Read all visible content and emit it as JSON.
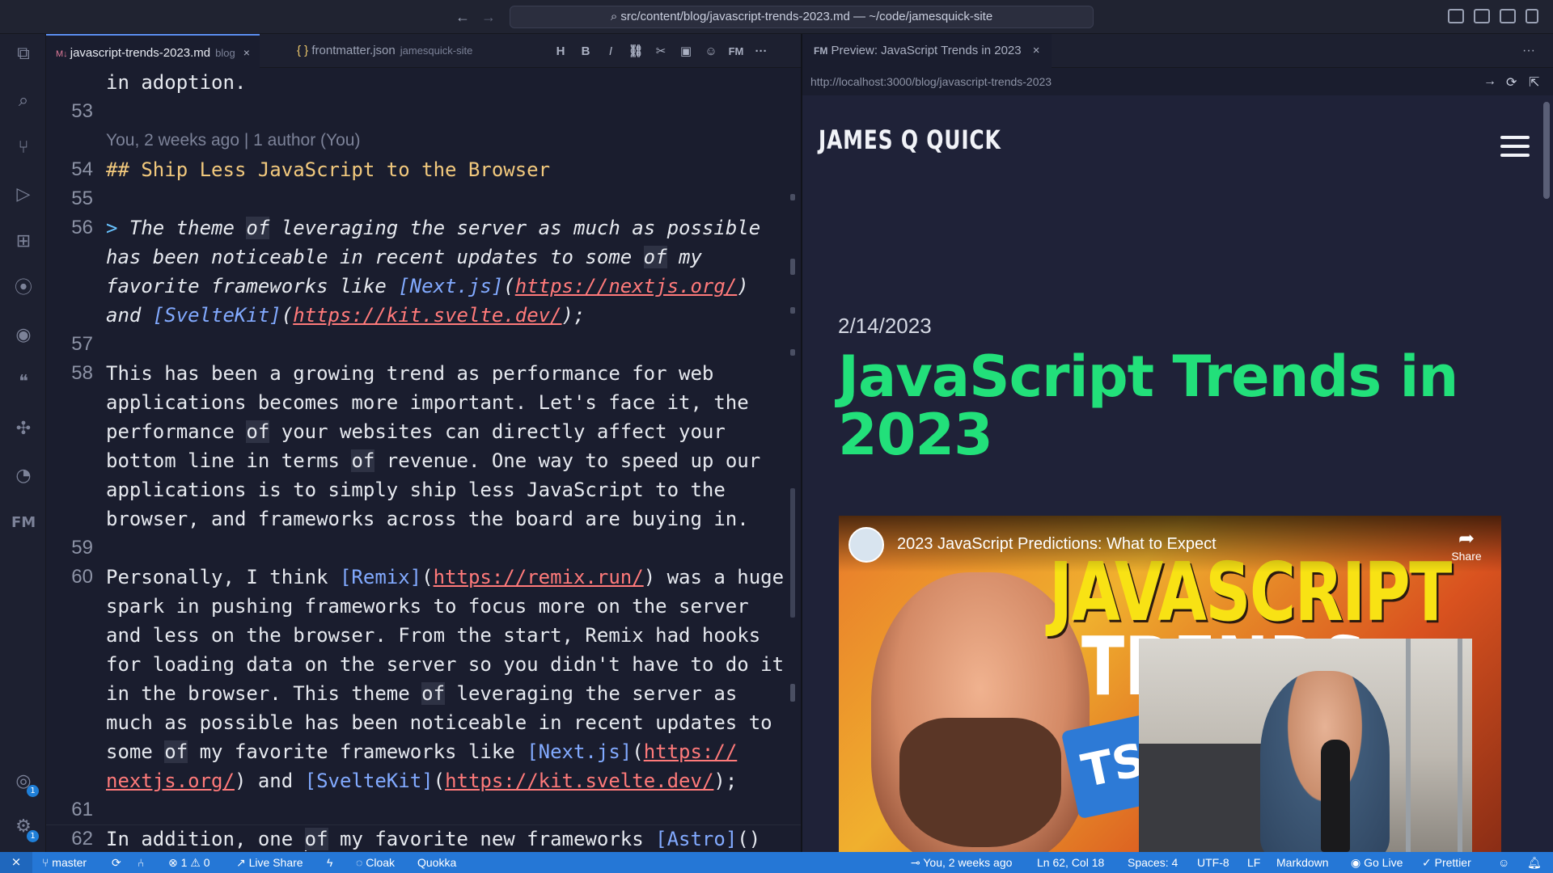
{
  "titlebar": {
    "back_icon": "arrow-left-icon",
    "forward_icon": "arrow-right-icon",
    "command_center": "src/content/blog/javascript-trends-2023.md — ~/code/jamesquick-site"
  },
  "activity_bar": {
    "items": [
      {
        "icon": "files-icon",
        "glyph": "⧉"
      },
      {
        "icon": "search-icon",
        "glyph": "⌕"
      },
      {
        "icon": "source-control-icon",
        "glyph": "⑂"
      },
      {
        "icon": "run-debug-icon",
        "glyph": "▷"
      },
      {
        "icon": "extensions-icon",
        "glyph": "⊞"
      },
      {
        "icon": "git-graph-icon",
        "glyph": "⦿"
      },
      {
        "icon": "github-icon",
        "glyph": "◉"
      },
      {
        "icon": "quote-icon",
        "glyph": "❝"
      },
      {
        "icon": "butterfly-icon",
        "glyph": "✣"
      },
      {
        "icon": "quokka-icon",
        "glyph": "◔"
      },
      {
        "icon": "frontmatter-icon",
        "glyph": "FM"
      }
    ],
    "accounts_badge": "1",
    "settings_badge": "1"
  },
  "editor_tabs": [
    {
      "label": "javascript-trends-2023.md",
      "sub": "blog",
      "close": "×",
      "active": true
    },
    {
      "label": "frontmatter.json",
      "sub": "jamesquick-site",
      "close": "",
      "active": false
    }
  ],
  "toolbar_glyphs": {
    "h": "H",
    "b": "B",
    "i": "I",
    "fm": "FM",
    "more": "···"
  },
  "editor": {
    "lines": [
      {
        "num": "",
        "segments": [
          {
            "t": "in adoption."
          }
        ]
      },
      {
        "num": "53",
        "segments": []
      },
      {
        "num": "",
        "blame": "You, 2 weeks ago | 1 author (You)",
        "segments": []
      },
      {
        "num": "54",
        "segments": [
          {
            "t": "## Ship Less JavaScript to the Browser",
            "c": "hd"
          }
        ]
      },
      {
        "num": "55",
        "segments": []
      },
      {
        "num": "56",
        "segments": [
          {
            "t": "> ",
            "c": "qmark"
          },
          {
            "t": "The theme ",
            "c": "quote"
          },
          {
            "t": "of",
            "c": "quote kw"
          },
          {
            "t": " leveraging the server as much as possible",
            "c": "quote"
          }
        ]
      },
      {
        "num": "",
        "segments": [
          {
            "t": "has been noticeable in recent updates to some ",
            "c": "quote"
          },
          {
            "t": "of",
            "c": "quote kw"
          },
          {
            "t": " my",
            "c": "quote"
          }
        ]
      },
      {
        "num": "",
        "segments": [
          {
            "t": "favorite frameworks like ",
            "c": "quote"
          },
          {
            "t": "[Next.js]",
            "c": "quote lt"
          },
          {
            "t": "(",
            "c": "quote"
          },
          {
            "t": "https://nextjs.org/",
            "c": "quote url"
          },
          {
            "t": ")",
            "c": "quote"
          }
        ]
      },
      {
        "num": "",
        "segments": [
          {
            "t": "and ",
            "c": "quote"
          },
          {
            "t": "[SvelteKit]",
            "c": "quote lt"
          },
          {
            "t": "(",
            "c": "quote"
          },
          {
            "t": "https://kit.svelte.dev/",
            "c": "quote url"
          },
          {
            "t": ");",
            "c": "quote"
          }
        ]
      },
      {
        "num": "57",
        "segments": []
      },
      {
        "num": "58",
        "segments": [
          {
            "t": "This has been a growing trend as performance for web"
          }
        ]
      },
      {
        "num": "",
        "segments": [
          {
            "t": "applications becomes more important. Let's face it, the"
          }
        ]
      },
      {
        "num": "",
        "segments": [
          {
            "t": "performance "
          },
          {
            "t": "of",
            "c": "kw"
          },
          {
            "t": " your websites can directly affect your"
          }
        ]
      },
      {
        "num": "",
        "segments": [
          {
            "t": "bottom line in terms "
          },
          {
            "t": "of",
            "c": "kw"
          },
          {
            "t": " revenue. One way to speed up our"
          }
        ]
      },
      {
        "num": "",
        "segments": [
          {
            "t": "applications is to simply ship less JavaScript to the"
          }
        ]
      },
      {
        "num": "",
        "segments": [
          {
            "t": "browser, and frameworks across the board are buying in."
          }
        ]
      },
      {
        "num": "59",
        "segments": []
      },
      {
        "num": "60",
        "segments": [
          {
            "t": "Personally, I think "
          },
          {
            "t": "[Remix]",
            "c": "lt"
          },
          {
            "t": "("
          },
          {
            "t": "https://remix.run/",
            "c": "url"
          },
          {
            "t": ") was a huge"
          }
        ]
      },
      {
        "num": "",
        "segments": [
          {
            "t": "spark in pushing frameworks to focus more on the server"
          }
        ]
      },
      {
        "num": "",
        "segments": [
          {
            "t": "and less on the browser. From the start, Remix had hooks"
          }
        ]
      },
      {
        "num": "",
        "segments": [
          {
            "t": "for loading data on the server so you didn't have to do it"
          }
        ]
      },
      {
        "num": "",
        "segments": [
          {
            "t": "in the browser. This theme "
          },
          {
            "t": "of",
            "c": "kw"
          },
          {
            "t": " leveraging the server as"
          }
        ]
      },
      {
        "num": "",
        "segments": [
          {
            "t": "much as possible has been noticeable in recent updates to"
          }
        ]
      },
      {
        "num": "",
        "segments": [
          {
            "t": "some "
          },
          {
            "t": "of",
            "c": "kw"
          },
          {
            "t": " my favorite frameworks like "
          },
          {
            "t": "[Next.js]",
            "c": "lt"
          },
          {
            "t": "("
          },
          {
            "t": "https://",
            "c": "url"
          }
        ]
      },
      {
        "num": "",
        "segments": [
          {
            "t": "nextjs.org/",
            "c": "url"
          },
          {
            "t": ") and "
          },
          {
            "t": "[SvelteKit]",
            "c": "lt"
          },
          {
            "t": "("
          },
          {
            "t": "https://kit.svelte.dev/",
            "c": "url"
          },
          {
            "t": ");"
          }
        ]
      },
      {
        "num": "61",
        "segments": []
      },
      {
        "num": "62",
        "current": true,
        "segments": [
          {
            "t": "In addition, one "
          },
          {
            "caret": true
          },
          {
            "t": "of",
            "c": "kw"
          },
          {
            "t": " my favorite new frameworks "
          },
          {
            "t": "[Astro]",
            "c": "lt"
          },
          {
            "t": "()"
          }
        ]
      }
    ]
  },
  "preview": {
    "tab_label": "Preview: JavaScript Trends in 2023",
    "tab_icon": "FM",
    "close": "×",
    "url": "http://localhost:3000/blog/javascript-trends-2023",
    "site_title": "JAMES Q QUICK",
    "post_date": "2/14/2023",
    "post_title": "JavaScript Trends in 2023",
    "video": {
      "title": "2023 JavaScript Predictions: What to Expect",
      "share": "Share",
      "thumb_text_1": "JAVASCRIPT",
      "thumb_text_2": "TRENDS",
      "ts_logo": "TS"
    }
  },
  "status_bar": {
    "remote": "⨯",
    "branch": "master",
    "sync": "⟳",
    "problems": "⊗ 1 ⚠ 0",
    "live_share": "Live Share",
    "cloak": "Cloak",
    "quokka": "Quokka",
    "blame": "You, 2 weeks ago",
    "cursor": "Ln 62, Col 18",
    "spaces": "Spaces: 4",
    "encoding": "UTF-8",
    "eol": "LF",
    "language": "Markdown",
    "go_live": "Go Live",
    "prettier": "Prettier"
  },
  "colors": {
    "accent": "#2577d6",
    "heading": "#f2c97d",
    "link_text": "#82aaff",
    "url": "#ff7a7a",
    "post_title": "#22e07a"
  }
}
